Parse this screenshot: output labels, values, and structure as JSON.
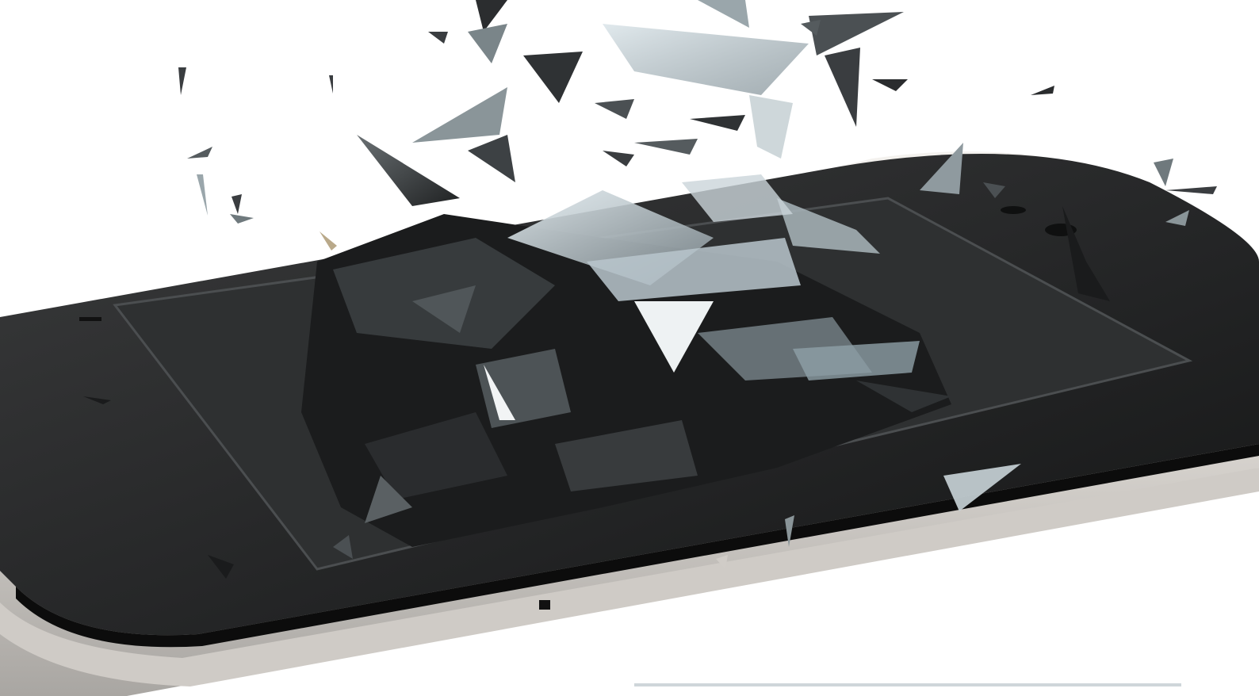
{
  "image": {
    "subject": "smartphone-shattered-screen",
    "colors": {
      "background": "#ffffff",
      "glass_dark": "#2b2b2b",
      "glass_mid": "#5d6366",
      "glass_light": "#c9d4d8",
      "body_silver": "#e6e3df",
      "bezel": "#1a1a1a"
    }
  }
}
